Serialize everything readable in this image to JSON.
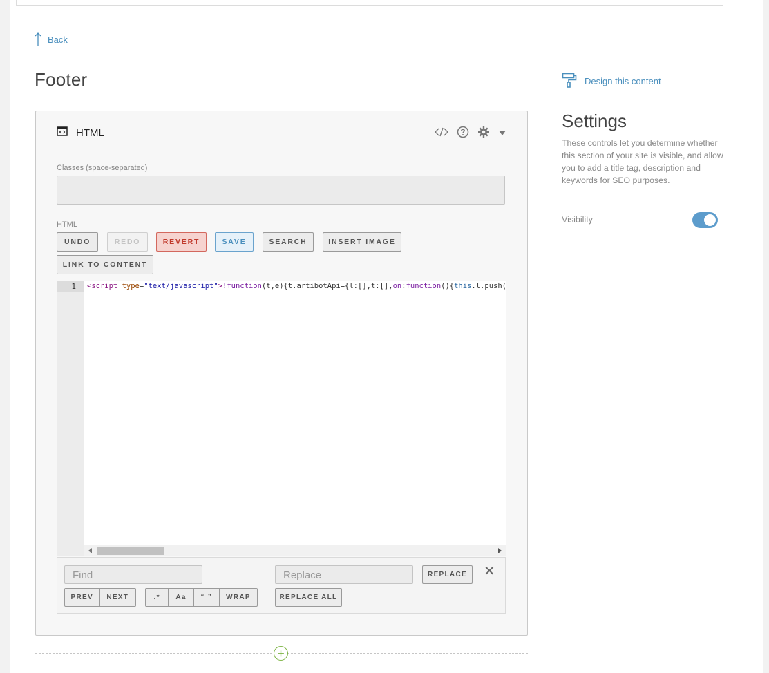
{
  "nav": {
    "back_label": "Back"
  },
  "page": {
    "title": "Footer"
  },
  "block": {
    "type_label": "HTML",
    "icons": [
      "code-icon",
      "help-icon",
      "gear-icon",
      "caret-down-icon"
    ],
    "classes_label": "Classes (space-separated)",
    "classes_value": "",
    "html_label": "HTML"
  },
  "toolbar": {
    "undo": "UNDO",
    "redo": "REDO",
    "revert": "REVERT",
    "save": "SAVE",
    "search": "SEARCH",
    "insert_image": "INSERT IMAGE",
    "link_to_content": "LINK TO CONTENT"
  },
  "editor": {
    "line_number": "1",
    "code_tokens": [
      {
        "cls": "tk-tag",
        "text": "<script"
      },
      {
        "cls": "",
        "text": " "
      },
      {
        "cls": "tk-attr",
        "text": "type"
      },
      {
        "cls": "",
        "text": "="
      },
      {
        "cls": "tk-str",
        "text": "\"text/javascript\""
      },
      {
        "cls": "tk-tag",
        "text": ">"
      },
      {
        "cls": "tk-kw",
        "text": "!function"
      },
      {
        "cls": "",
        "text": "(t,e){t.artibotApi={l:[],t:[],"
      },
      {
        "cls": "tk-kw",
        "text": "on"
      },
      {
        "cls": "",
        "text": ":"
      },
      {
        "cls": "tk-kw",
        "text": "function"
      },
      {
        "cls": "",
        "text": "(){"
      },
      {
        "cls": "tk-def",
        "text": "this"
      },
      {
        "cls": "",
        "text": ".l.push(arguments)},"
      }
    ]
  },
  "find": {
    "find_placeholder": "Find",
    "replace_placeholder": "Replace",
    "replace": "REPLACE",
    "replace_all": "REPLACE ALL",
    "prev": "PREV",
    "next": "NEXT",
    "regex": ".*",
    "case": "Aa",
    "word": "“ ”",
    "wrap": "WRAP"
  },
  "sidebar": {
    "design_label": "Design this content",
    "settings_title": "Settings",
    "settings_desc": "These controls let you determine whether this section of your site is visible, and allow you to add a title tag, description and keywords for SEO purposes.",
    "visibility_label": "Visibility",
    "visibility_on": true
  },
  "colors": {
    "accent": "#4a8fbd",
    "add": "#7cb342",
    "revert": "#c0392b",
    "toggle": "#5c9ccc"
  }
}
